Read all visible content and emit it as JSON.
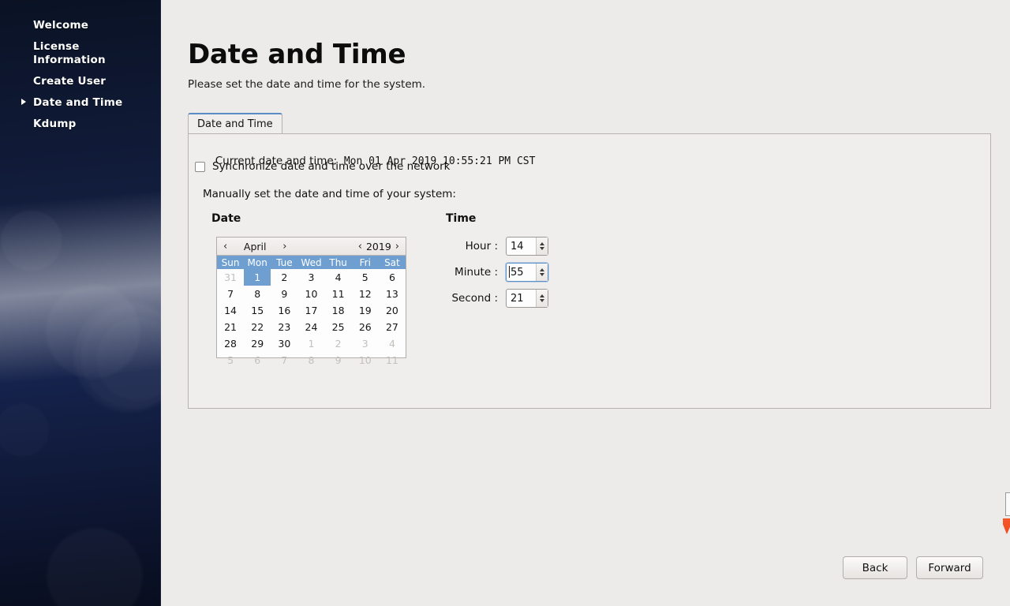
{
  "sidebar": {
    "items": [
      {
        "label": "Welcome",
        "active": false
      },
      {
        "label": "License Information",
        "active": false
      },
      {
        "label": "Create User",
        "active": false
      },
      {
        "label": "Date and Time",
        "active": true
      },
      {
        "label": "Kdump",
        "active": false
      }
    ]
  },
  "page": {
    "title": "Date and Time",
    "subtitle": "Please set the date and time for the system."
  },
  "tabs": [
    {
      "label": "Date and Time",
      "selected": true
    }
  ],
  "panel": {
    "current_label": "Current date and time:",
    "current_value": "Mon 01 Apr 2019 10:55:21 PM CST",
    "sync_checkbox_label": "Synchronize date and time over the network",
    "sync_checked": false,
    "manual_label": "Manually set the date and time of your system:",
    "date_section_title": "Date",
    "time_section_title": "Time"
  },
  "calendar": {
    "prev_month_icon": "‹",
    "next_month_icon": "›",
    "prev_year_icon": "‹",
    "next_year_icon": "›",
    "month": "April",
    "year": "2019",
    "day_headers": [
      "Sun",
      "Mon",
      "Tue",
      "Wed",
      "Thu",
      "Fri",
      "Sat"
    ],
    "selected_day": 1,
    "weeks": [
      [
        {
          "d": "31",
          "other": true
        },
        {
          "d": "1",
          "other": false,
          "sel": true
        },
        {
          "d": "2",
          "other": false
        },
        {
          "d": "3",
          "other": false
        },
        {
          "d": "4",
          "other": false
        },
        {
          "d": "5",
          "other": false
        },
        {
          "d": "6",
          "other": false
        }
      ],
      [
        {
          "d": "7",
          "other": false
        },
        {
          "d": "8",
          "other": false
        },
        {
          "d": "9",
          "other": false
        },
        {
          "d": "10",
          "other": false
        },
        {
          "d": "11",
          "other": false
        },
        {
          "d": "12",
          "other": false
        },
        {
          "d": "13",
          "other": false
        }
      ],
      [
        {
          "d": "14",
          "other": false
        },
        {
          "d": "15",
          "other": false
        },
        {
          "d": "16",
          "other": false
        },
        {
          "d": "17",
          "other": false
        },
        {
          "d": "18",
          "other": false
        },
        {
          "d": "19",
          "other": false
        },
        {
          "d": "20",
          "other": false
        }
      ],
      [
        {
          "d": "21",
          "other": false
        },
        {
          "d": "22",
          "other": false
        },
        {
          "d": "23",
          "other": false
        },
        {
          "d": "24",
          "other": false
        },
        {
          "d": "25",
          "other": false
        },
        {
          "d": "26",
          "other": false
        },
        {
          "d": "27",
          "other": false
        }
      ],
      [
        {
          "d": "28",
          "other": false
        },
        {
          "d": "29",
          "other": false
        },
        {
          "d": "30",
          "other": false
        },
        {
          "d": "1",
          "other": true
        },
        {
          "d": "2",
          "other": true
        },
        {
          "d": "3",
          "other": true
        },
        {
          "d": "4",
          "other": true
        }
      ],
      [
        {
          "d": "5",
          "other": true
        },
        {
          "d": "6",
          "other": true
        },
        {
          "d": "7",
          "other": true
        },
        {
          "d": "8",
          "other": true
        },
        {
          "d": "9",
          "other": true
        },
        {
          "d": "10",
          "other": true
        },
        {
          "d": "11",
          "other": true
        }
      ]
    ]
  },
  "time": {
    "hour_label": "Hour :",
    "hour_value": "14",
    "minute_label": "Minute :",
    "minute_value": "55",
    "minute_focused": true,
    "second_label": "Second :",
    "second_value": "21"
  },
  "footer": {
    "back_label": "Back",
    "forward_label": "Forward"
  },
  "colors": {
    "sidebar_dark": "#0a1224",
    "sidebar_mid": "#17265 1",
    "accent_blue": "#6e9fd0",
    "tab_active_top": "#5a8bc4",
    "page_bg": "#edebe9",
    "panel_bg": "#f0eeec",
    "cursor_orange": "#f4562a"
  }
}
